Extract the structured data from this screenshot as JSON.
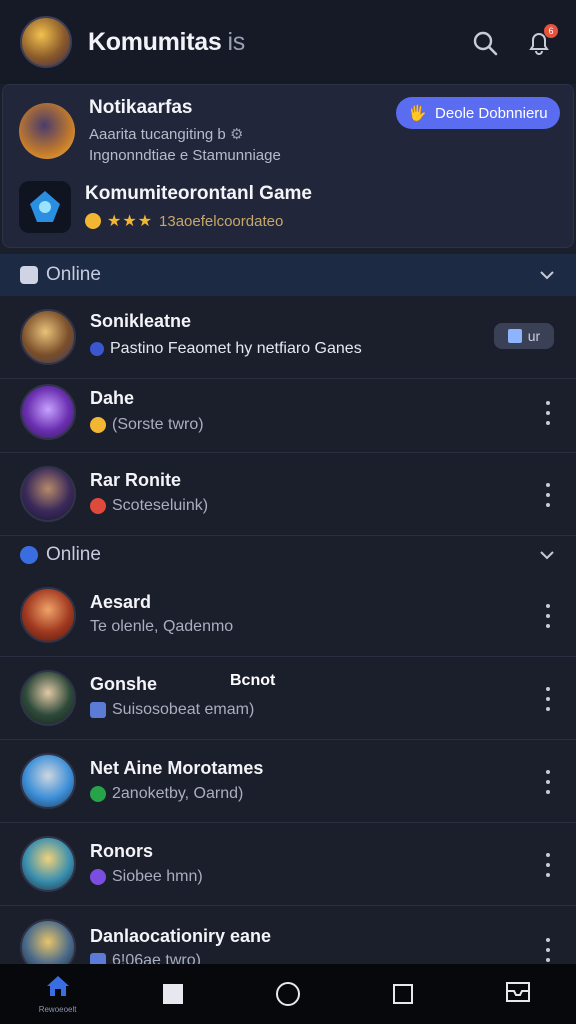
{
  "header": {
    "title": "Komumitas",
    "title_suffix": "is",
    "notification_count": "6"
  },
  "notifications": [
    {
      "title": "Notikaarfas",
      "line1": "Aaarita tucangiting b",
      "line2": "Ingnonndtiae e Stamunniage",
      "button_label": "Deole Dobnnieru"
    },
    {
      "title": "Komumiteorontanl Game",
      "rating": "★★★",
      "rating_text": "13aoefelcoordateo"
    }
  ],
  "sections": [
    {
      "label": "Online",
      "friends": [
        {
          "name": "Sonikleatne",
          "status": "Pastino Feaomet hy netfiaro Ganes",
          "button": "ur"
        }
      ]
    },
    {
      "label": "Online",
      "friends": []
    }
  ],
  "friends_group1": [
    {
      "name": "Sonikleatne",
      "status": "Pastino Feaomet hy netfiaro Ganes",
      "button": "ur"
    },
    {
      "name": "Dahe",
      "status": "(Sorste twro)"
    },
    {
      "name": "Rar Ronite",
      "status": "Scoteseluink)"
    }
  ],
  "section2_label": "Online",
  "friends_group2": [
    {
      "name": "Aesard",
      "status": "Te olenle, Qadenmo"
    },
    {
      "name": "Gonshe",
      "status": "Suisosobeat emam)",
      "tag": "Bcnot"
    },
    {
      "name": "Net Aine Morotames",
      "status": "2anoketby, Oarnd)"
    },
    {
      "name": "Ronors",
      "status": "Siobee hmn)"
    },
    {
      "name": "Danlaocationiry eane",
      "status": "6!06ae twro)"
    }
  ],
  "section1_label": "Online",
  "nav": {
    "home_label": "Rewoeoelt"
  },
  "colors": {
    "accent": "#5a6cf0",
    "background": "#1b1e2b",
    "online": "#27a348"
  }
}
